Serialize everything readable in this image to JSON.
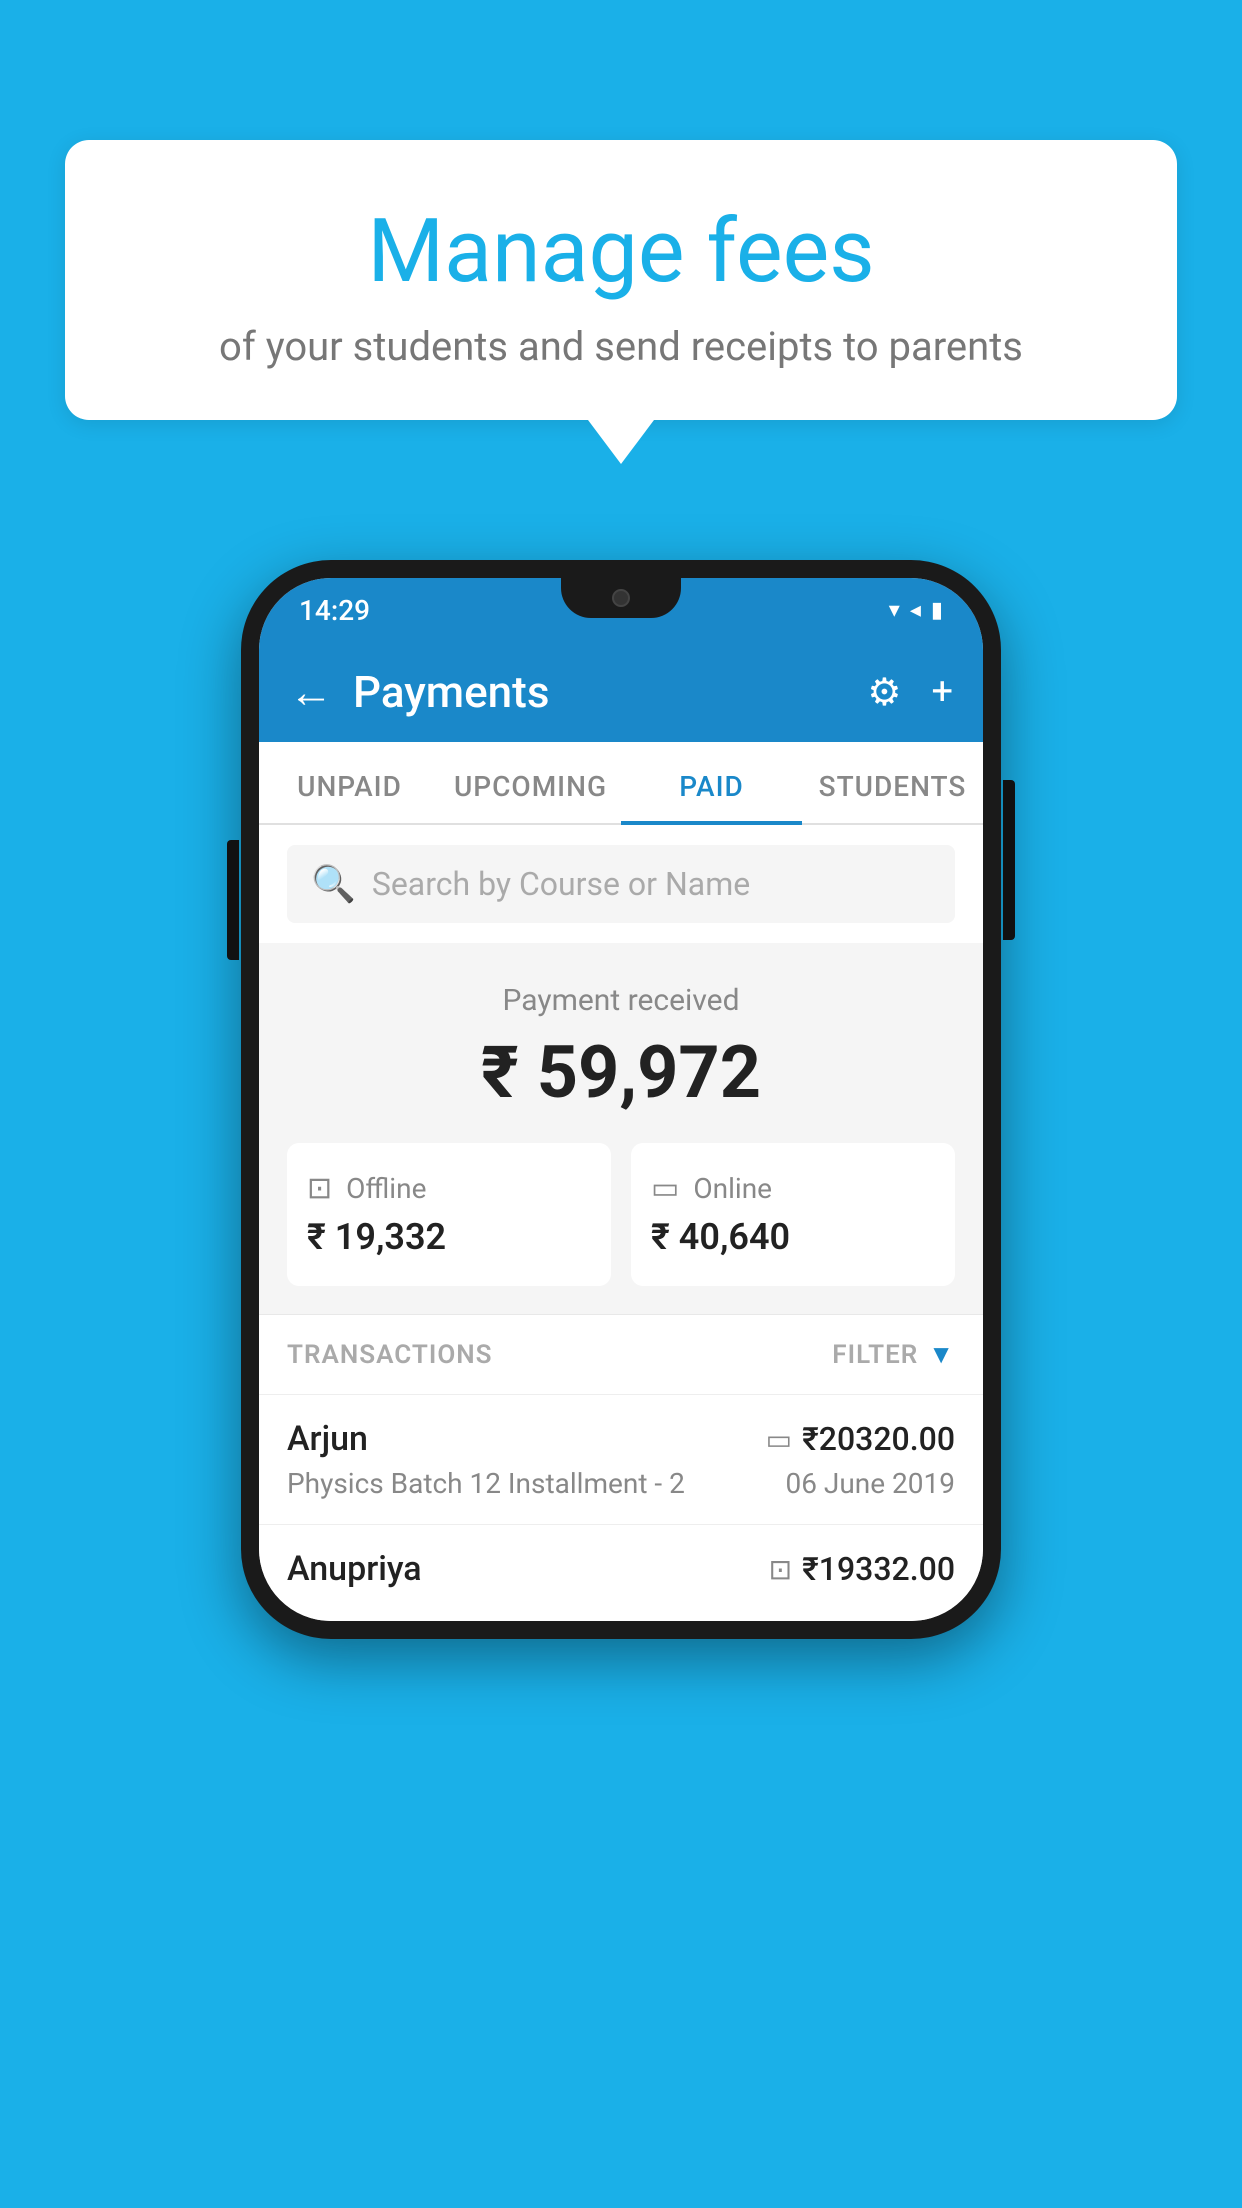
{
  "page": {
    "background_color": "#1ab0e8"
  },
  "speech_bubble": {
    "title": "Manage fees",
    "subtitle": "of your students and send receipts to parents"
  },
  "status_bar": {
    "time": "14:29",
    "wifi_icon": "▼",
    "signal_icon": "▲",
    "battery_icon": "▮"
  },
  "app_bar": {
    "back_label": "←",
    "title": "Payments",
    "gear_label": "⚙",
    "plus_label": "+"
  },
  "tabs": [
    {
      "label": "UNPAID",
      "active": false
    },
    {
      "label": "UPCOMING",
      "active": false
    },
    {
      "label": "PAID",
      "active": true
    },
    {
      "label": "STUDENTS",
      "active": false
    }
  ],
  "search": {
    "placeholder": "Search by Course or Name",
    "icon": "🔍"
  },
  "payment_summary": {
    "received_label": "Payment received",
    "total_amount": "₹ 59,972",
    "offline": {
      "label": "Offline",
      "amount": "₹ 19,332"
    },
    "online": {
      "label": "Online",
      "amount": "₹ 40,640"
    }
  },
  "transactions": {
    "header_label": "TRANSACTIONS",
    "filter_label": "FILTER",
    "items": [
      {
        "name": "Arjun",
        "course": "Physics Batch 12 Installment - 2",
        "amount": "₹20320.00",
        "date": "06 June 2019",
        "type": "online"
      },
      {
        "name": "Anupriya",
        "course": "",
        "amount": "₹19332.00",
        "date": "",
        "type": "offline"
      }
    ]
  }
}
